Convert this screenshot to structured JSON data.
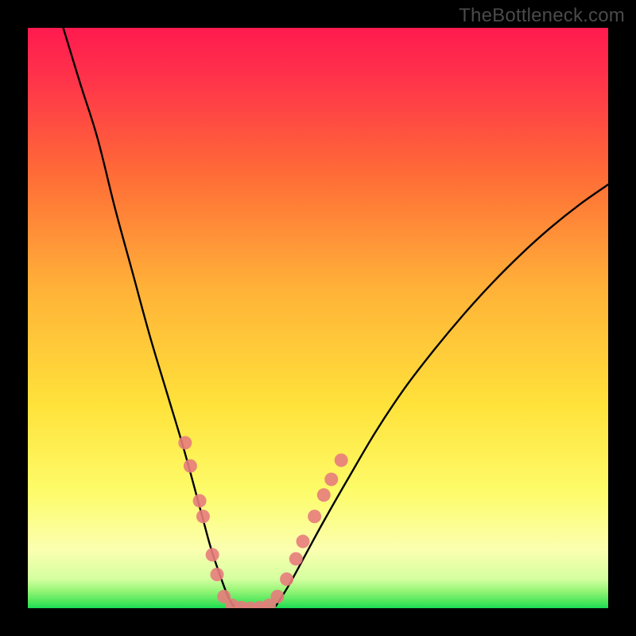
{
  "watermark": "TheBottleneck.com",
  "chart_data": {
    "type": "line",
    "title": "",
    "xlabel": "",
    "ylabel": "",
    "xlim": [
      0,
      1
    ],
    "ylim": [
      0,
      1
    ],
    "background_gradient": {
      "top": "#ff1a4f",
      "mid1": "#ff7a2a",
      "mid2": "#ffe23a",
      "light": "#ffffa8",
      "green": "#1fdc55"
    },
    "series": [
      {
        "name": "left-curve",
        "type": "line",
        "color": "#000000",
        "x": [
          0.061,
          0.09,
          0.12,
          0.15,
          0.18,
          0.21,
          0.24,
          0.27,
          0.3,
          0.315,
          0.33,
          0.345,
          0.357
        ],
        "y": [
          1.0,
          0.905,
          0.81,
          0.69,
          0.58,
          0.47,
          0.37,
          0.27,
          0.16,
          0.105,
          0.06,
          0.02,
          0.0
        ]
      },
      {
        "name": "right-curve",
        "type": "line",
        "color": "#000000",
        "x": [
          0.425,
          0.45,
          0.48,
          0.51,
          0.55,
          0.6,
          0.65,
          0.7,
          0.75,
          0.8,
          0.85,
          0.9,
          0.95,
          1.0
        ],
        "y": [
          0.0,
          0.04,
          0.095,
          0.15,
          0.22,
          0.305,
          0.38,
          0.445,
          0.505,
          0.56,
          0.61,
          0.655,
          0.695,
          0.73
        ]
      },
      {
        "name": "valley",
        "type": "line",
        "color": "#000000",
        "x": [
          0.357,
          0.39,
          0.408,
          0.425
        ],
        "y": [
          0.0,
          0.0,
          0.0,
          0.0
        ]
      },
      {
        "name": "flat-green-line",
        "type": "line",
        "color": "#1fdc55",
        "x": [
          0.0,
          1.0
        ],
        "y": [
          0.0,
          0.0
        ]
      },
      {
        "name": "highlighted-points-left",
        "type": "scatter",
        "color": "#e77c7c",
        "x": [
          0.271,
          0.28,
          0.296,
          0.302,
          0.318,
          0.326,
          0.338
        ],
        "y": [
          0.285,
          0.245,
          0.185,
          0.158,
          0.092,
          0.058,
          0.02
        ]
      },
      {
        "name": "highlighted-points-right",
        "type": "scatter",
        "color": "#e77c7c",
        "x": [
          0.43,
          0.446,
          0.462,
          0.474,
          0.494,
          0.51,
          0.523,
          0.54
        ],
        "y": [
          0.02,
          0.05,
          0.085,
          0.115,
          0.158,
          0.195,
          0.222,
          0.255
        ]
      },
      {
        "name": "highlighted-points-valley",
        "type": "scatter",
        "color": "#e77c7c",
        "x": [
          0.352,
          0.368,
          0.384,
          0.4,
          0.416
        ],
        "y": [
          0.005,
          0.001,
          0.0,
          0.001,
          0.005
        ]
      }
    ]
  }
}
